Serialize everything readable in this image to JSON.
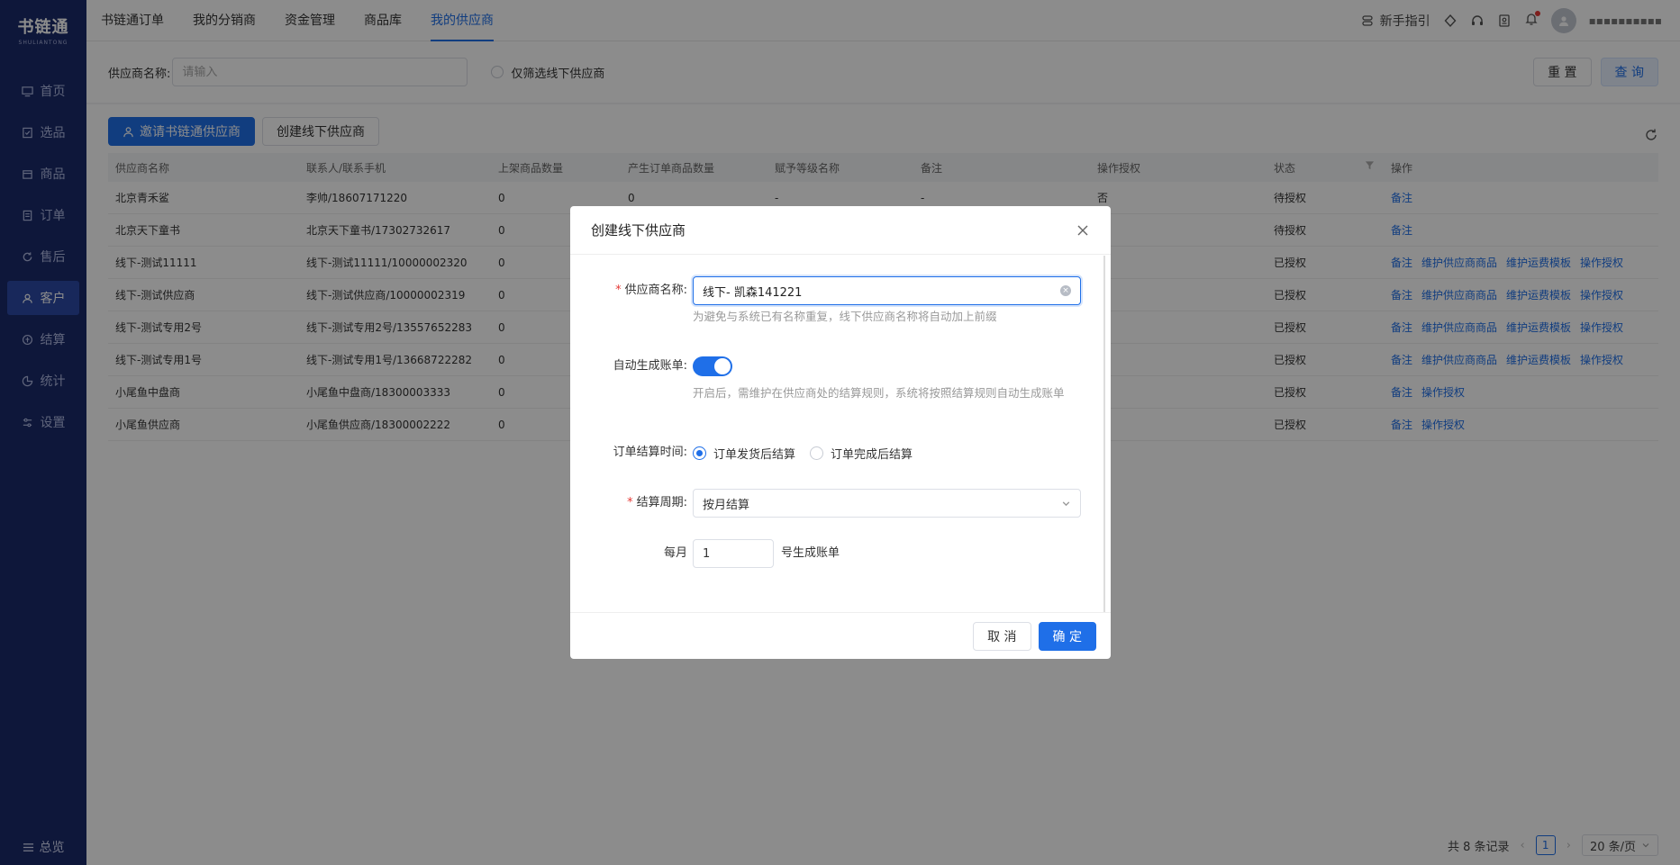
{
  "app": {
    "logo_main": "书链通",
    "logo_sub": "SHULIANTONG"
  },
  "sidebar": {
    "items": [
      {
        "label": "首页",
        "icon": "monitor-icon"
      },
      {
        "label": "选品",
        "icon": "checklist-icon"
      },
      {
        "label": "商品",
        "icon": "box-icon"
      },
      {
        "label": "订单",
        "icon": "document-icon"
      },
      {
        "label": "售后",
        "icon": "refresh-icon"
      },
      {
        "label": "客户",
        "icon": "users-icon",
        "active": true
      },
      {
        "label": "结算",
        "icon": "settle-icon"
      },
      {
        "label": "统计",
        "icon": "pie-icon"
      },
      {
        "label": "设置",
        "icon": "sliders-icon"
      }
    ],
    "bottom_label": "总览"
  },
  "topnav": {
    "tabs": [
      "书链通订单",
      "我的分销商",
      "资金管理",
      "商品库",
      "我的供应商"
    ],
    "active_tab": "我的供应商",
    "guide_label": "新手指引",
    "user_name": "▪▪▪▪▪▪▪▪▪▪"
  },
  "filter": {
    "name_label": "供应商名称:",
    "name_placeholder": "请输入",
    "offline_only_label": "仅筛选线下供应商",
    "reset_label": "重 置",
    "search_label": "查 询"
  },
  "toolbar": {
    "invite_label": "邀请书链通供应商",
    "create_label": "创建线下供应商"
  },
  "table": {
    "headers": [
      "供应商名称",
      "联系人/联系手机",
      "上架商品数量",
      "产生订单商品数量",
      "赋予等级名称",
      "备注",
      "操作授权",
      "状态",
      "操作"
    ],
    "rows": [
      {
        "name": "北京青禾鲨",
        "contact": "李帅/18607171220",
        "listed": "0",
        "ordered": "0",
        "level": "-",
        "remark": "-",
        "auth": "否",
        "status": "待授权",
        "actions": [
          "备注"
        ]
      },
      {
        "name": "北京天下童书",
        "contact": "北京天下童书/17302732617",
        "listed": "0",
        "ordered": "",
        "level": "",
        "remark": "",
        "auth": "",
        "status": "待授权",
        "actions": [
          "备注"
        ]
      },
      {
        "name": "线下-测试11111",
        "contact": "线下-测试11111/10000002320",
        "listed": "0",
        "ordered": "",
        "level": "",
        "remark": "",
        "auth": "",
        "status": "已授权",
        "actions": [
          "备注",
          "维护供应商商品",
          "维护运费模板",
          "操作授权"
        ]
      },
      {
        "name": "线下-测试供应商",
        "contact": "线下-测试供应商/10000002319",
        "listed": "0",
        "ordered": "",
        "level": "",
        "remark": "",
        "auth": "",
        "status": "已授权",
        "actions": [
          "备注",
          "维护供应商商品",
          "维护运费模板",
          "操作授权"
        ]
      },
      {
        "name": "线下-测试专用2号",
        "contact": "线下-测试专用2号/13557652283",
        "listed": "0",
        "ordered": "",
        "level": "",
        "remark": "",
        "auth": "",
        "status": "已授权",
        "actions": [
          "备注",
          "维护供应商商品",
          "维护运费模板",
          "操作授权"
        ]
      },
      {
        "name": "线下-测试专用1号",
        "contact": "线下-测试专用1号/13668722282",
        "listed": "0",
        "ordered": "",
        "level": "",
        "remark": "",
        "auth": "",
        "status": "已授权",
        "actions": [
          "备注",
          "维护供应商商品",
          "维护运费模板",
          "操作授权"
        ]
      },
      {
        "name": "小尾鱼中盘商",
        "contact": "小尾鱼中盘商/18300003333",
        "listed": "0",
        "ordered": "",
        "level": "",
        "remark": "",
        "auth": "",
        "status": "已授权",
        "actions": [
          "备注",
          "操作授权"
        ]
      },
      {
        "name": "小尾鱼供应商",
        "contact": "小尾鱼供应商/18300002222",
        "listed": "0",
        "ordered": "",
        "level": "",
        "remark": "",
        "auth": "",
        "status": "已授权",
        "actions": [
          "备注",
          "操作授权"
        ]
      }
    ]
  },
  "pagination": {
    "total_label": "共 8 条记录",
    "current_page": "1",
    "page_size": "20 条/页"
  },
  "modal": {
    "title": "创建线下供应商",
    "name_label": "供应商名称:",
    "name_value": "线下- 凯森141221",
    "name_hint": "为避免与系统已有名称重复，线下供应商名称将自动加上前缀",
    "auto_bill_label": "自动生成账单:",
    "auto_bill_on": true,
    "auto_bill_hint": "开启后，需维护在供应商处的结算规则，系统将按照结算规则自动生成账单",
    "settle_time_label": "订单结算时间:",
    "settle_time_options": [
      "订单发货后结算",
      "订单完成后结算"
    ],
    "settle_time_selected": "订单发货后结算",
    "cycle_label": "结算周期:",
    "cycle_value": "按月结算",
    "monthly_prefix": "每月",
    "monthly_day": "1",
    "monthly_suffix": "号生成账单",
    "cancel_label": "取 消",
    "confirm_label": "确 定"
  },
  "colors": {
    "primary": "#1f6fe8",
    "sidebar_bg": "#1b2a6b",
    "required": "#e53935"
  }
}
